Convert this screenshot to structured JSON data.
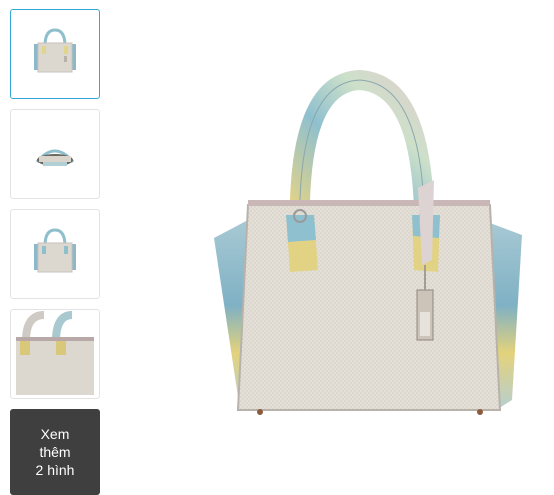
{
  "gallery": {
    "thumbnails": [
      {
        "alt_icon": "handbag-front-icon",
        "selected": true
      },
      {
        "alt_icon": "handbag-top-icon",
        "selected": false
      },
      {
        "alt_icon": "handbag-back-icon",
        "selected": false
      },
      {
        "alt_icon": "handbag-closeup-icon",
        "selected": false
      }
    ],
    "more_button": {
      "line1": "Xem",
      "line2": "thêm",
      "line3": "2 hình"
    },
    "main_image": {
      "icon": "handbag-image"
    },
    "colors": {
      "selected_border": "#33a7d6",
      "more_bg": "#3f3f3f"
    }
  }
}
